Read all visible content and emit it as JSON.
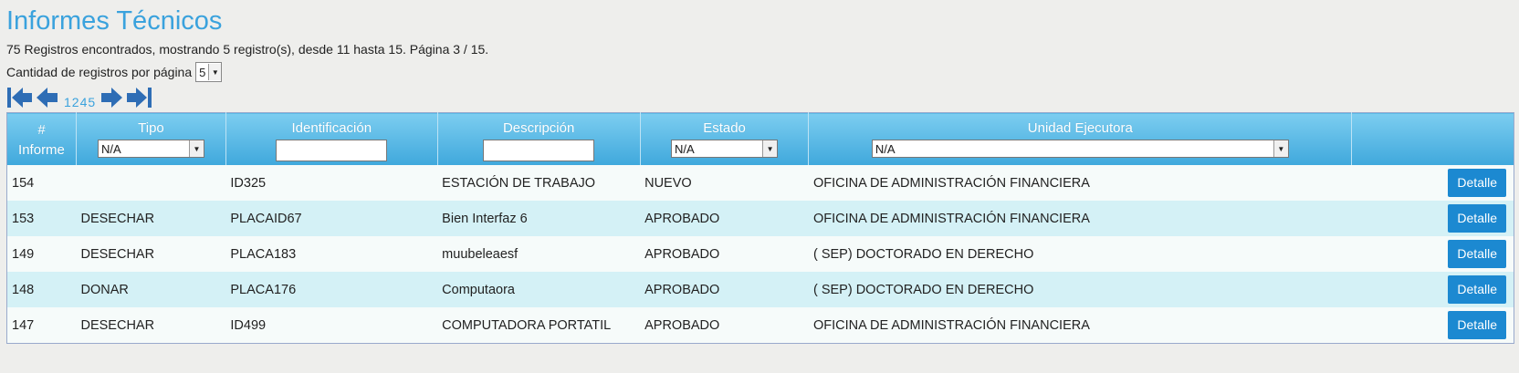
{
  "page": {
    "title": "Informes Técnicos",
    "summary": "75 Registros encontrados, mostrando 5 registro(s), desde 11 hasta 15. Página 3 / 15.",
    "per_page_label": "Cantidad de registros por página",
    "per_page_value": "5"
  },
  "pager": {
    "pages": [
      "1",
      "2",
      "4",
      "5"
    ]
  },
  "table": {
    "headers": {
      "informe": "# Informe",
      "tipo": "Tipo",
      "identificacion": "Identificación",
      "descripcion": "Descripción",
      "estado": "Estado",
      "unidad": "Unidad Ejecutora"
    },
    "filters": {
      "tipo": "N/A",
      "estado": "N/A",
      "unidad": "N/A"
    },
    "rows": [
      {
        "informe": "154",
        "tipo": "",
        "identificacion": "ID325",
        "descripcion": "ESTACIÓN DE TRABAJO",
        "estado": "NUEVO",
        "unidad": "OFICINA DE ADMINISTRACIÓN FINANCIERA",
        "accion": "Detalle"
      },
      {
        "informe": "153",
        "tipo": "DESECHAR",
        "identificacion": "PLACAID67",
        "descripcion": "Bien Interfaz 6",
        "estado": "APROBADO",
        "unidad": "OFICINA DE ADMINISTRACIÓN FINANCIERA",
        "accion": "Detalle"
      },
      {
        "informe": "149",
        "tipo": "DESECHAR",
        "identificacion": "PLACA183",
        "descripcion": "muubeleaesf",
        "estado": "APROBADO",
        "unidad": "( SEP) DOCTORADO EN DERECHO",
        "accion": "Detalle"
      },
      {
        "informe": "148",
        "tipo": "DONAR",
        "identificacion": "PLACA176",
        "descripcion": "Computaora",
        "estado": "APROBADO",
        "unidad": "( SEP) DOCTORADO EN DERECHO",
        "accion": "Detalle"
      },
      {
        "informe": "147",
        "tipo": "DESECHAR",
        "identificacion": "ID499",
        "descripcion": "COMPUTADORA PORTATIL",
        "estado": "APROBADO",
        "unidad": "OFICINA DE ADMINISTRACIÓN FINANCIERA",
        "accion": "Detalle"
      }
    ]
  },
  "colors": {
    "title": "#3aa2dd",
    "header_top": "#7ccdf0",
    "header_bottom": "#3fa8dc",
    "row_even": "#d4f1f6",
    "button": "#1c89d1"
  }
}
